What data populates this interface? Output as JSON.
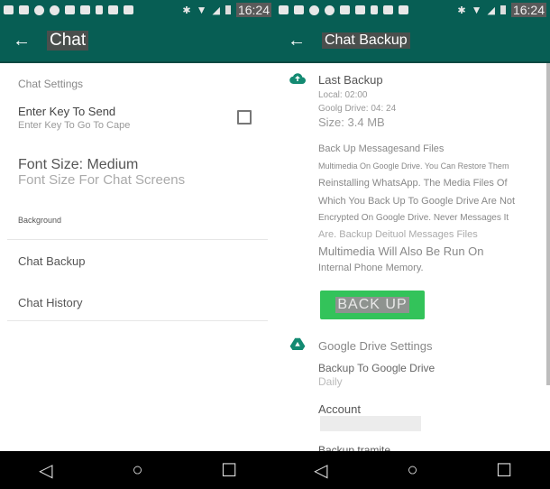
{
  "status_bar": {
    "time_left": "16:24",
    "time_right": "16:24",
    "notification_icons": [
      "image-icon",
      "gmail-icon",
      "settings-icon",
      "settings-icon",
      "youtube-icon",
      "youtube-icon",
      "download-icon",
      "camera-icon",
      "camera-icon"
    ],
    "system_icons": [
      "bluetooth-icon",
      "wifi-icon",
      "signal-icon",
      "battery-icon"
    ]
  },
  "left_screen": {
    "title": "Chat",
    "section_header": "Chat Settings",
    "enter_key": {
      "title": "Enter Key To Send",
      "subtitle": "Enter Key To Go To Cape",
      "checked": false
    },
    "font_size": {
      "title": "Font Size: Medium",
      "subtitle": "Font Size For Chat Screens"
    },
    "background_label": "Background",
    "chat_backup_label": "Chat Backup",
    "chat_history_label": "Chat History"
  },
  "right_screen": {
    "title": "Chat Backup",
    "last_backup": {
      "heading": "Last Backup",
      "local": "Local: 02:00",
      "google_drive": "Goolg Drive: 04: 24",
      "size": "Size: 3.4 MB"
    },
    "description": [
      "Back Up Messagesand Files",
      "Multimedia On Google Drive. You Can Restore Them",
      "Reinstalling WhatsApp. The Media Files Of",
      "Which You Back Up To Google Drive Are Not",
      "Encrypted On Google Drive. Never Messages It",
      "Are. Backup Deituol Messages Files",
      "Multimedia Will Also Be Run On",
      "Internal Phone Memory."
    ],
    "backup_button": "BACK UP",
    "google_drive_settings": {
      "heading": "Google Drive Settings",
      "backup_to_drive_label": "Backup To Google Drive",
      "backup_to_drive_value": "Daily",
      "account_label": "Account",
      "account_value": "",
      "backup_via_label": "Backup tramite"
    }
  },
  "nav_bar": {
    "back": "◁",
    "home": "○",
    "recents": "☐"
  },
  "colors": {
    "primary": "#075e54",
    "accent": "#33c35a"
  }
}
